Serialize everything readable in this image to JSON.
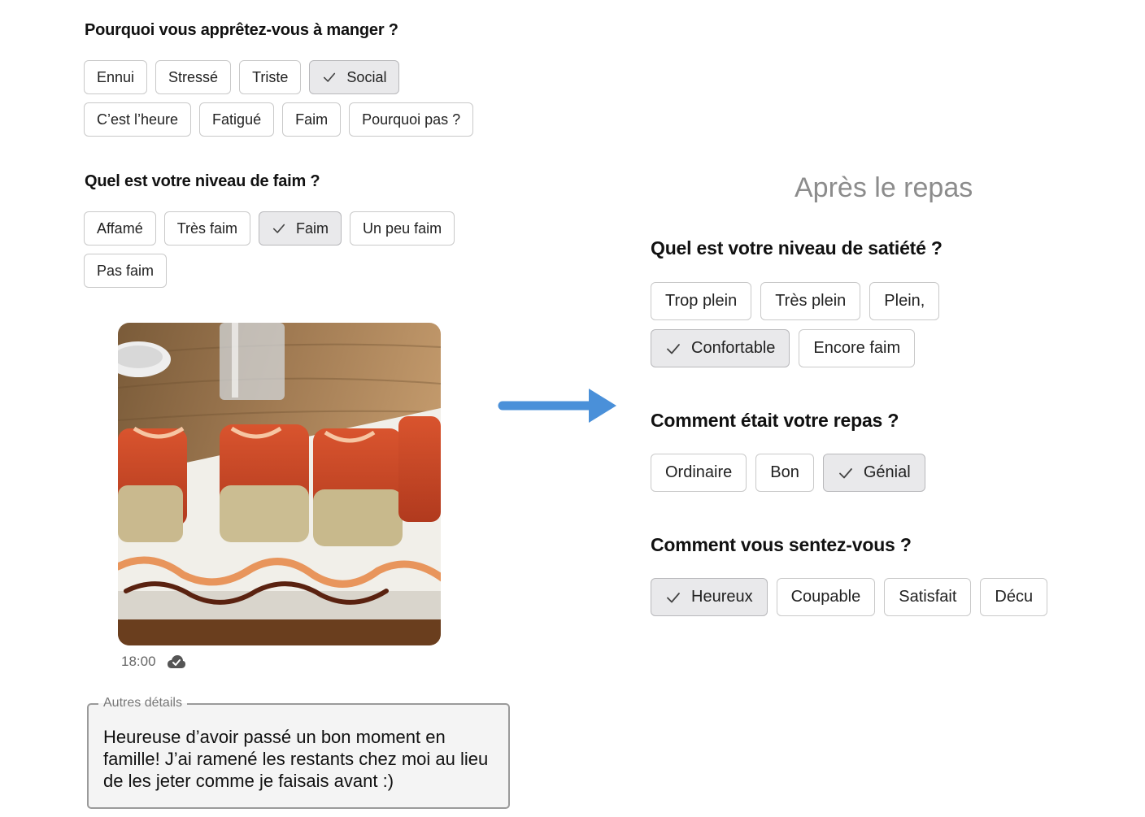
{
  "before": {
    "why_question": "Pourquoi vous apprêtez-vous à manger ?",
    "why_options": [
      {
        "label": "Ennui",
        "selected": false
      },
      {
        "label": "Stressé",
        "selected": false
      },
      {
        "label": "Triste",
        "selected": false
      },
      {
        "label": "Social",
        "selected": true
      },
      {
        "label": "C’est l’heure",
        "selected": false
      },
      {
        "label": "Fatigué",
        "selected": false
      },
      {
        "label": "Faim",
        "selected": false
      },
      {
        "label": "Pourquoi pas ?",
        "selected": false
      }
    ],
    "hunger_question": "Quel est votre niveau de faim ?",
    "hunger_options": [
      {
        "label": "Affamé",
        "selected": false
      },
      {
        "label": "Très faim",
        "selected": false
      },
      {
        "label": "Faim",
        "selected": true
      },
      {
        "label": "Un peu faim",
        "selected": false
      },
      {
        "label": "Pas faim",
        "selected": false
      }
    ],
    "photo_icon": "sushi-roll-photo",
    "time": "18:00",
    "sync_icon": "cloud-check-icon",
    "details_label": "Autres détails",
    "details_text": "Heureuse d’avoir passé un bon moment en famille! J’ai ramené les restants chez moi au lieu de les jeter comme je faisais avant :)"
  },
  "transition_icon": "arrow-right-icon",
  "after": {
    "title": "Après le repas",
    "satiety_question": "Quel est votre niveau de satiété ?",
    "satiety_options": [
      {
        "label": "Trop plein",
        "selected": false
      },
      {
        "label": "Très plein",
        "selected": false
      },
      {
        "label": "Plein,",
        "selected": false
      },
      {
        "label": "Confortable",
        "selected": true
      },
      {
        "label": "Encore faim",
        "selected": false
      }
    ],
    "meal_question": "Comment était votre repas ?",
    "meal_options": [
      {
        "label": "Ordinaire",
        "selected": false
      },
      {
        "label": "Bon",
        "selected": false
      },
      {
        "label": "Génial",
        "selected": true
      }
    ],
    "feeling_question": "Comment vous sentez-vous ?",
    "feeling_options": [
      {
        "label": "Heureux",
        "selected": true
      },
      {
        "label": "Coupable",
        "selected": false
      },
      {
        "label": "Satisfait",
        "selected": false
      },
      {
        "label": "Décu",
        "selected": false
      }
    ]
  },
  "colors": {
    "arrow": "#4a90d9",
    "selected_chip_bg": "#e9e9eb",
    "chip_border": "#c9c9c9",
    "title_grey": "#8c8c8c"
  }
}
